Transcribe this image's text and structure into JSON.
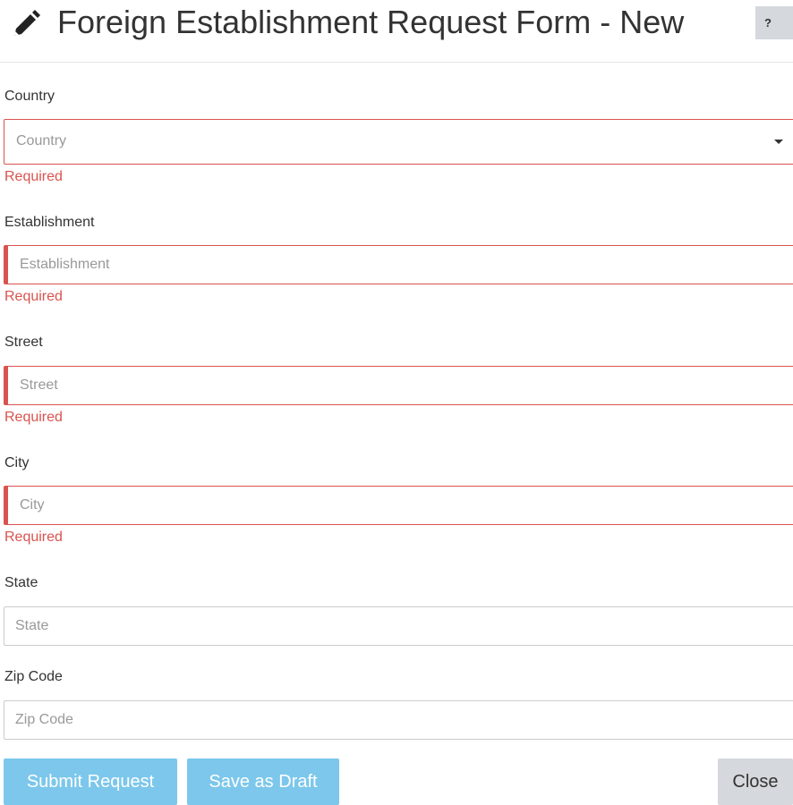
{
  "header": {
    "title": "Foreign Establishment Request Form - New",
    "help_label": "?"
  },
  "form": {
    "country": {
      "label": "Country",
      "placeholder": "Country",
      "error": "Required"
    },
    "establishment": {
      "label": "Establishment",
      "placeholder": "Establishment",
      "error": "Required"
    },
    "street": {
      "label": "Street",
      "placeholder": "Street",
      "error": "Required"
    },
    "city": {
      "label": "City",
      "placeholder": "City",
      "error": "Required"
    },
    "state": {
      "label": "State",
      "placeholder": "State"
    },
    "zip": {
      "label": "Zip Code",
      "placeholder": "Zip Code"
    }
  },
  "actions": {
    "submit_label": "Submit Request",
    "draft_label": "Save as Draft",
    "close_label": "Close"
  },
  "colors": {
    "error": "#d9534f",
    "primary_button": "#7cc7eb",
    "secondary_button": "#d5d8dc"
  },
  "icons": {
    "header": "pencil-icon",
    "country_dropdown": "caret-down-icon"
  }
}
